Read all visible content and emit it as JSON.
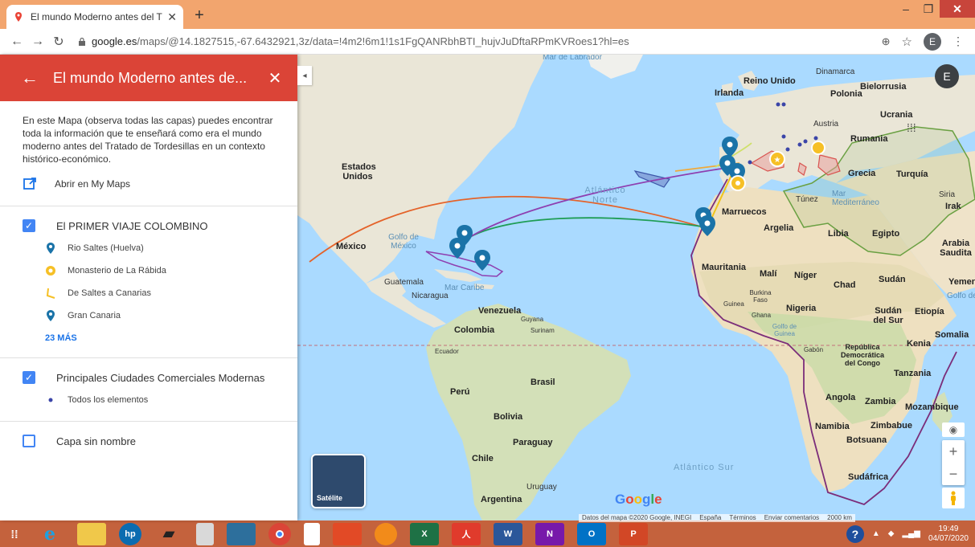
{
  "browser": {
    "tab_title": "El mundo Moderno antes del Tra",
    "url_host": "google.es",
    "url_path": "/maps/@14.1827515,-67.6432921,3z/data=!4m2!6m1!1s1FgQANRbhBTI_hujvJuDftaRPmKVRoes1?hl=es",
    "avatar_letter": "E"
  },
  "panel": {
    "title": "El mundo Moderno antes de...",
    "description": "En este Mapa (observa todas las capas) puedes encontrar toda la información que te enseñará como era el mundo moderno antes del Tratado de Tordesillas en un contexto histórico-económico.",
    "open_link": "Abrir en My Maps",
    "layers": [
      {
        "name": "El PRIMER VIAJE COLOMBINO",
        "checked": true,
        "items": [
          {
            "label": "Rio Saltes (Huelva)",
            "icon": "blue-pin-icon"
          },
          {
            "label": "Monasterio de La Rábida",
            "icon": "yellow-circle-icon"
          },
          {
            "label": "De Saltes a Canarias",
            "icon": "yellow-line-icon"
          },
          {
            "label": "Gran Canaria",
            "icon": "blue-pin-icon"
          }
        ],
        "more": "23 MÁS"
      },
      {
        "name": "Principales Ciudades Comerciales Modernas",
        "checked": true,
        "items": [
          {
            "label": "Todos los elementos",
            "icon": "dot-icon"
          }
        ]
      },
      {
        "name": "Capa sin nombre",
        "checked": false,
        "items": []
      }
    ]
  },
  "map": {
    "satellite_label": "Satélite",
    "google": "Google",
    "avatar_letter": "E",
    "attribution": [
      "Datos del mapa ©2020 Google, INEGI",
      "España",
      "Términos",
      "Enviar comentarios",
      "2000 km"
    ],
    "labels": {
      "mar_labrador": "Mar de Labrador",
      "reino_unido": "Reino Unido",
      "irlanda": "Irlanda",
      "dinamarca": "Dinamarca",
      "bielorrusia": "Bielorrusia",
      "polonia": "Polonia",
      "ucrania": "Ucrania",
      "austria": "Austria",
      "rumania": "Rumania",
      "grecia": "Grecia",
      "turquia": "Turquía",
      "siria": "Siria",
      "irak": "Irak",
      "tunez": "Túnez",
      "mar_med": "Mar Mediterráneo",
      "marruecos": "Marruecos",
      "argelia": "Argelia",
      "libia": "Libia",
      "egipto": "Egipto",
      "arabia": "Arabia Saudita",
      "estados_unidos": "Estados Unidos",
      "mexico": "México",
      "golfo_mexico": "Golfo de México",
      "atlantico_norte": "Atlántico Norte",
      "guatemala": "Guatemala",
      "nicaragua": "Nicaragua",
      "mar_caribe": "Mar Caribe",
      "mauritania": "Mauritania",
      "mali": "Malí",
      "niger": "Níger",
      "chad": "Chad",
      "sudan": "Sudán",
      "yemen": "Yemen",
      "golfo_aden": "Golfo de Adén",
      "burkina": "Burkina Faso",
      "guinea": "Guinea",
      "ghana": "Ghana",
      "nigeria": "Nigeria",
      "sudan_sur": "Sudán del Sur",
      "etiopia": "Etiopía",
      "somalia": "Somalia",
      "kenia": "Kenia",
      "venezuela": "Venezuela",
      "guyana": "Guyana",
      "surinam": "Surinam",
      "colombia": "Colombia",
      "ecuador": "Ecuador",
      "peru": "Perú",
      "brasil": "Brasil",
      "bolivia": "Bolivia",
      "paraguay": "Paraguay",
      "chile": "Chile",
      "uruguay": "Uruguay",
      "argentina": "Argentina",
      "golfo_guinea": "Golfo de Guinea",
      "gabon": "Gabón",
      "congo": "República Democrática del Congo",
      "tanzania": "Tanzania",
      "angola": "Angola",
      "zambia": "Zambia",
      "mozambique": "Mozambique",
      "namibia": "Namibia",
      "zimbabue": "Zimbabue",
      "botsuana": "Botsuana",
      "sudafrica": "Sudáfrica",
      "atlantico_sur": "Atlántico Sur"
    }
  },
  "taskbar": {
    "time": "19:49",
    "date": "04/07/2020"
  }
}
